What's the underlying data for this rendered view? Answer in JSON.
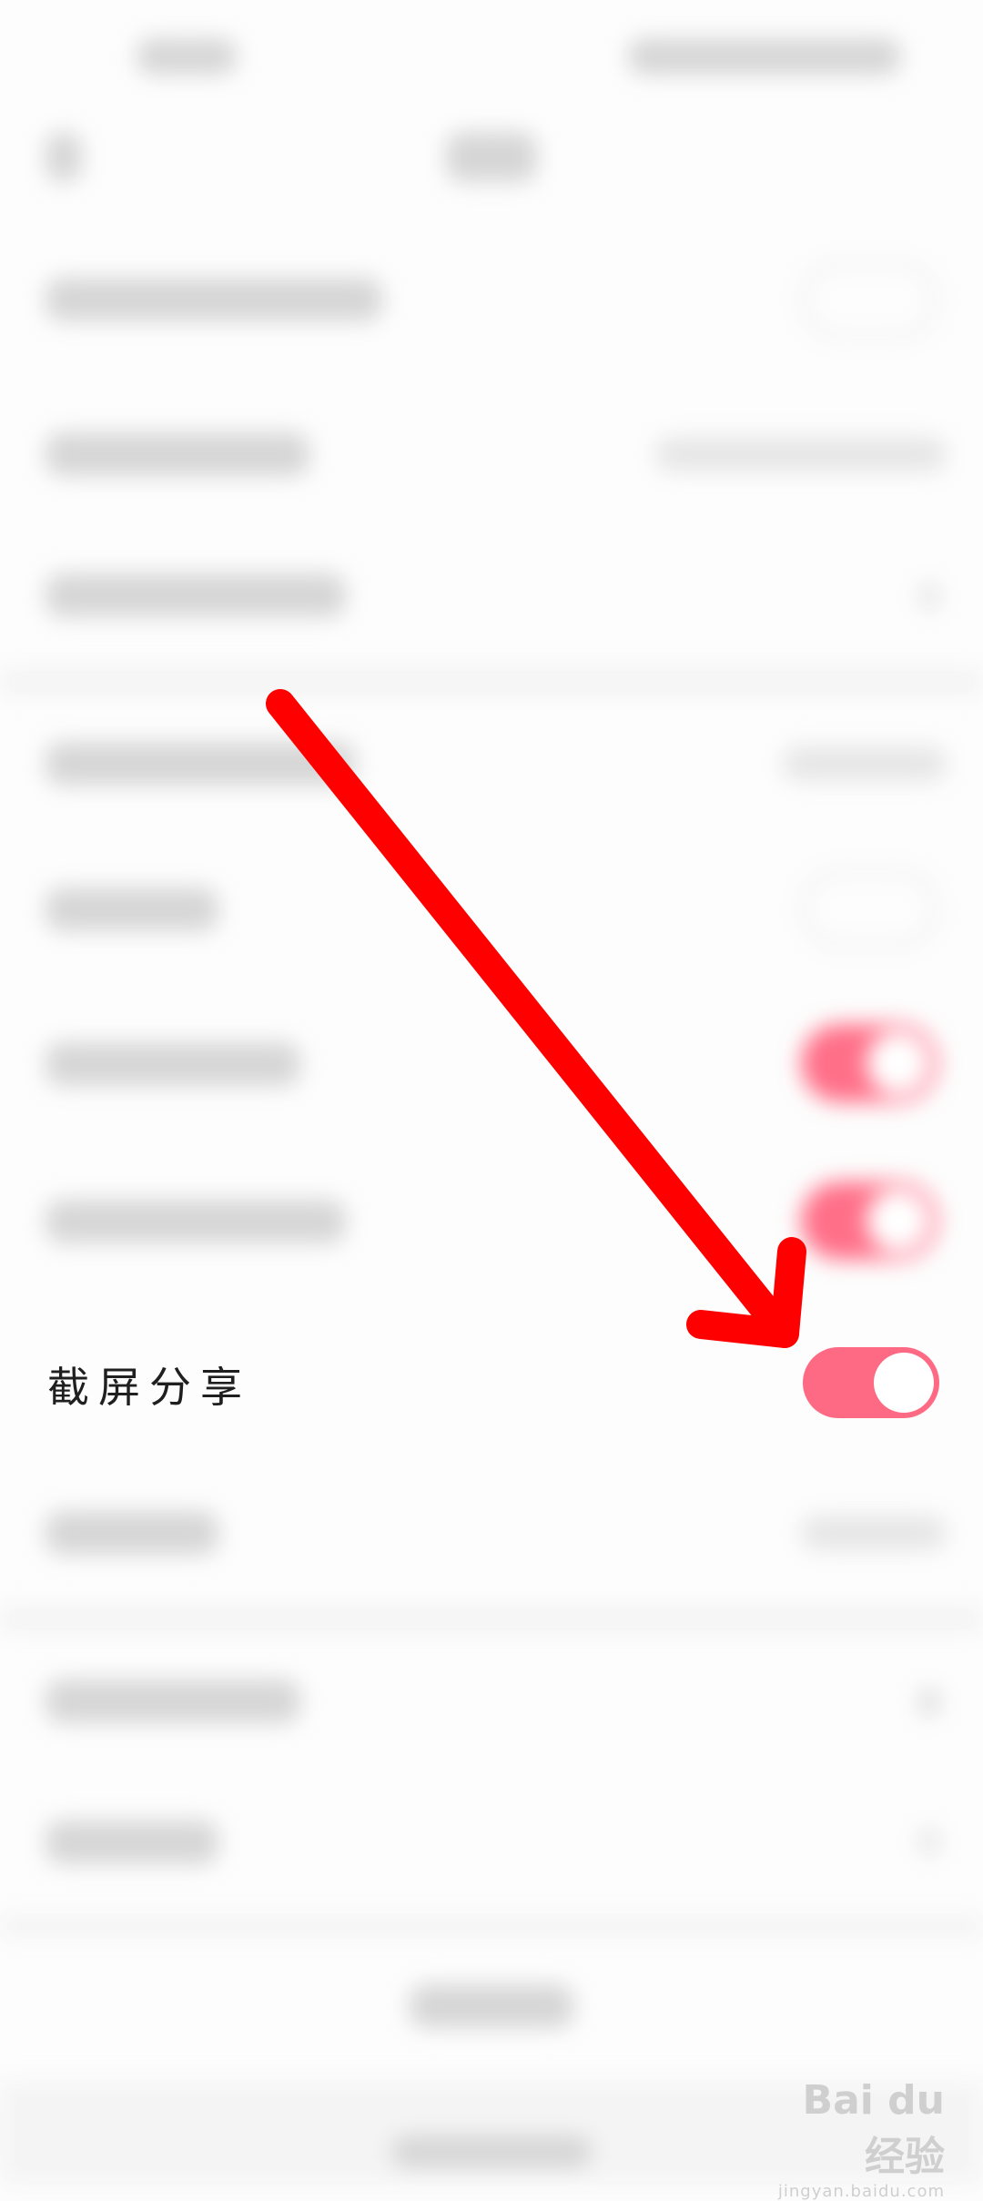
{
  "settings": {
    "screenshot_share": {
      "label": "截屏分享",
      "enabled": true
    }
  },
  "colors": {
    "toggle_on": "#fe6a84",
    "annotation_arrow": "#ff0000"
  },
  "watermark": {
    "logo": "Bai du 经验",
    "subtitle": "jingyan.baidu.com"
  }
}
